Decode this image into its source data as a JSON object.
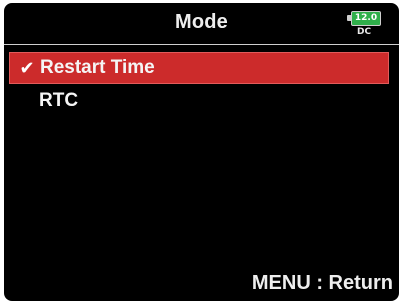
{
  "header": {
    "title": "Mode",
    "battery": {
      "value": "12.0",
      "source": "DC"
    }
  },
  "menu": {
    "items": [
      {
        "label": "Restart Time",
        "selected": true,
        "icon": "check-icon"
      },
      {
        "label": "RTC",
        "selected": false
      }
    ]
  },
  "footer": {
    "hint": "MENU : Return"
  },
  "colors": {
    "background": "#000000",
    "selection": "#cc2b2b",
    "battery": "#2faf4a",
    "text": "#f2f2f2"
  }
}
